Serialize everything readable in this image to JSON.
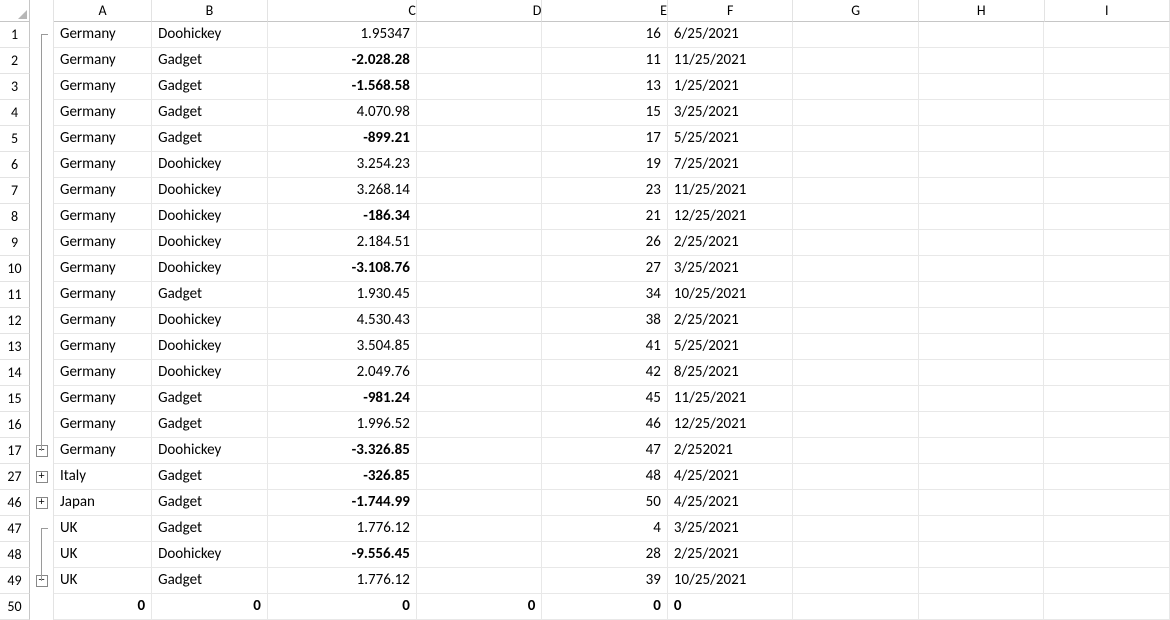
{
  "columns": [
    "A",
    "B",
    "C",
    "D",
    "E",
    "F",
    "G",
    "H",
    "I"
  ],
  "rows": [
    {
      "n": 1,
      "outline": "top-tee",
      "A": "Germany",
      "B": "Doohickey",
      "C": "1.95347",
      "neg": false,
      "E": "16",
      "F": "6/25/2021"
    },
    {
      "n": 2,
      "outline": "line",
      "A": "Germany",
      "B": "Gadget",
      "C": "-2.028.28",
      "neg": true,
      "E": "11",
      "F": "11/25/2021"
    },
    {
      "n": 3,
      "outline": "line",
      "A": "Germany",
      "B": "Gadget",
      "C": "-1.568.58",
      "neg": true,
      "E": "13",
      "F": "1/25/2021"
    },
    {
      "n": 4,
      "outline": "line",
      "A": "Germany",
      "B": "Gadget",
      "C": "4.070.98",
      "neg": false,
      "E": "15",
      "F": "3/25/2021"
    },
    {
      "n": 5,
      "outline": "line",
      "A": "Germany",
      "B": "Gadget",
      "C": "-899.21",
      "neg": true,
      "E": "17",
      "F": "5/25/2021"
    },
    {
      "n": 6,
      "outline": "line",
      "A": "Germany",
      "B": "Doohickey",
      "C": "3.254.23",
      "neg": false,
      "E": "19",
      "F": "7/25/2021"
    },
    {
      "n": 7,
      "outline": "line",
      "A": "Germany",
      "B": "Doohickey",
      "C": "3.268.14",
      "neg": false,
      "E": "23",
      "F": "11/25/2021"
    },
    {
      "n": 8,
      "outline": "line",
      "A": "Germany",
      "B": "Doohickey",
      "C": "-186.34",
      "neg": true,
      "E": "21",
      "F": "12/25/2021"
    },
    {
      "n": 9,
      "outline": "line",
      "A": "Germany",
      "B": "Doohickey",
      "C": "2.184.51",
      "neg": false,
      "E": "26",
      "F": "2/25/2021"
    },
    {
      "n": 10,
      "outline": "line",
      "A": "Germany",
      "B": "Doohickey",
      "C": "-3.108.76",
      "neg": true,
      "E": "27",
      "F": "3/25/2021"
    },
    {
      "n": 11,
      "outline": "line",
      "A": "Germany",
      "B": "Gadget",
      "C": "1.930.45",
      "neg": false,
      "E": "34",
      "F": "10/25/2021"
    },
    {
      "n": 12,
      "outline": "line",
      "A": "Germany",
      "B": "Doohickey",
      "C": "4.530.43",
      "neg": false,
      "E": "38",
      "F": "2/25/2021"
    },
    {
      "n": 13,
      "outline": "line",
      "A": "Germany",
      "B": "Doohickey",
      "C": "3.504.85",
      "neg": false,
      "E": "41",
      "F": "5/25/2021"
    },
    {
      "n": 14,
      "outline": "line",
      "A": "Germany",
      "B": "Doohickey",
      "C": "2.049.76",
      "neg": false,
      "E": "42",
      "F": "8/25/2021"
    },
    {
      "n": 15,
      "outline": "line",
      "A": "Germany",
      "B": "Gadget",
      "C": "-981.24",
      "neg": true,
      "E": "45",
      "F": "11/25/2021"
    },
    {
      "n": 16,
      "outline": "line",
      "A": "Germany",
      "B": "Gadget",
      "C": "1.996.52",
      "neg": false,
      "E": "46",
      "F": "12/25/2021"
    },
    {
      "n": 17,
      "outline": "minus",
      "A": "Germany",
      "B": "Doohickey",
      "C": "-3.326.85",
      "neg": true,
      "E": "47",
      "F": "2/252021"
    },
    {
      "n": 27,
      "outline": "plus",
      "A": "Italy",
      "B": "Gadget",
      "C": "-326.85",
      "neg": true,
      "E": "48",
      "F": "4/25/2021"
    },
    {
      "n": 46,
      "outline": "plus",
      "A": "Japan",
      "B": "Gadget",
      "C": "-1.744.99",
      "neg": true,
      "E": "50",
      "F": "4/25/2021"
    },
    {
      "n": 47,
      "outline": "top-tee",
      "A": "UK",
      "B": "Gadget",
      "C": "1.776.12",
      "neg": false,
      "E": "4",
      "F": "3/25/2021"
    },
    {
      "n": 48,
      "outline": "line",
      "A": "UK",
      "B": "Doohickey",
      "C": "-9.556.45",
      "neg": true,
      "E": "28",
      "F": "2/25/2021"
    },
    {
      "n": 49,
      "outline": "minus",
      "A": "UK",
      "B": "Gadget",
      "C": "1.776.12",
      "neg": false,
      "E": "39",
      "F": "10/25/2021"
    },
    {
      "n": 50,
      "outline": "none",
      "A": "0",
      "B": "0",
      "C": "0",
      "neg": false,
      "D": "0",
      "E": "0",
      "F": "0",
      "boldrow": true
    }
  ],
  "toggles": {
    "plus": "+",
    "minus": "−"
  }
}
